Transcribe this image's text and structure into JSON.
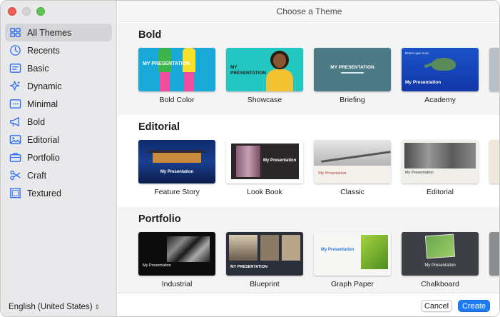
{
  "window": {
    "title": "Choose a Theme"
  },
  "sidebar": {
    "items": [
      {
        "label": "All Themes",
        "icon": "grid-icon",
        "selected": true
      },
      {
        "label": "Recents",
        "icon": "clock-icon",
        "selected": false
      },
      {
        "label": "Basic",
        "icon": "basic-slide-icon",
        "selected": false
      },
      {
        "label": "Dynamic",
        "icon": "sparkles-icon",
        "selected": false
      },
      {
        "label": "Minimal",
        "icon": "minimal-slide-icon",
        "selected": false
      },
      {
        "label": "Bold",
        "icon": "megaphone-icon",
        "selected": false
      },
      {
        "label": "Editorial",
        "icon": "photo-icon",
        "selected": false
      },
      {
        "label": "Portfolio",
        "icon": "briefcase-icon",
        "selected": false
      },
      {
        "label": "Craft",
        "icon": "scissors-icon",
        "selected": false
      },
      {
        "label": "Textured",
        "icon": "textured-frame-icon",
        "selected": false
      }
    ],
    "language": "English (United States)",
    "language_chevron": "⌃⌄"
  },
  "sections": [
    {
      "title": "Bold",
      "themes": [
        {
          "name": "Bold Color",
          "thumb_text": "MY PRESENTATION"
        },
        {
          "name": "Showcase",
          "thumb_text": "MY PRESENTATION"
        },
        {
          "name": "Briefing",
          "thumb_text": "MY PRESENTATION"
        },
        {
          "name": "Academy",
          "thumb_text": "My Presentation",
          "thumb_sub": "Donec quis nunc"
        }
      ]
    },
    {
      "title": "Editorial",
      "themes": [
        {
          "name": "Feature Story",
          "thumb_text": "My Presentation"
        },
        {
          "name": "Look Book",
          "thumb_text": "My Presentation"
        },
        {
          "name": "Classic",
          "thumb_text": "My Presentation"
        },
        {
          "name": "Editorial",
          "thumb_text": "My Presentation"
        }
      ]
    },
    {
      "title": "Portfolio",
      "themes": [
        {
          "name": "Industrial",
          "thumb_text": "My Presentation"
        },
        {
          "name": "Blueprint",
          "thumb_text": "MY PRESENTATION"
        },
        {
          "name": "Graph Paper",
          "thumb_text": "My Presentation"
        },
        {
          "name": "Chalkboard",
          "thumb_text": "My Presentation"
        }
      ]
    }
  ],
  "footer": {
    "cancel_label": "Cancel",
    "create_label": "Create"
  },
  "colors": {
    "accent": "#1f7bf5",
    "sidebar_bg": "#e9e8ea",
    "icon": "#2a6df4"
  }
}
